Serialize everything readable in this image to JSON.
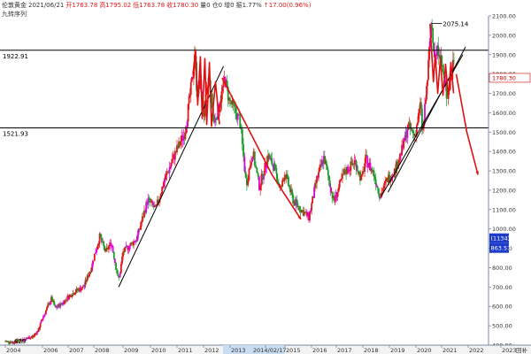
{
  "header": {
    "instrument": "伦敦黄金",
    "date": "2021/06/21",
    "open": "开1763.78",
    "high": "高1795.02",
    "low": "低1763.78",
    "close": "收1780.30",
    "volume": "量0",
    "oi": "仓0",
    "increment": "增0",
    "amplitude": "振1.77%",
    "change": "↑17.00(0.96%)"
  },
  "subtitle": "九转序列",
  "corner_label": "回补",
  "colors": {
    "up": "#e0181a",
    "down": "#1a9b2d",
    "magenta": "#e600e6",
    "red_line": "#e01010",
    "box_blue": "#1e3cc8"
  },
  "chart_data": {
    "type": "candlestick",
    "x_ticks": [
      "2004",
      "2006",
      "2007",
      "2008",
      "2009",
      "2010",
      "2011",
      "2012",
      "2013",
      "2014/02/17",
      "2015",
      "2016",
      "2017",
      "2018",
      "2019",
      "2020",
      "2021",
      "2022",
      "2023"
    ],
    "ylim": [
      400,
      2100
    ],
    "y_ticks": [
      400,
      500,
      600,
      700,
      800,
      900,
      1000,
      1100,
      1200,
      1300,
      1400,
      1500,
      1600,
      1700,
      1800,
      1900,
      2000,
      2100
    ],
    "levels": [
      1922.91,
      1521.93
    ],
    "level_labels": [
      "1922.91",
      "1521.93"
    ],
    "last_price": 1780.3,
    "last_price_label": "1780.30",
    "peak": {
      "label": "2075.14",
      "value": 2075.14,
      "date": "2020.6"
    },
    "low_label": "429",
    "cursor_value": "1000.00",
    "count_label": "(1134)",
    "low_readout": "863.57",
    "price_path": [
      [
        2004.0,
        420
      ],
      [
        2004.4,
        415
      ],
      [
        2005.0,
        430
      ],
      [
        2005.5,
        445
      ],
      [
        2005.8,
        480
      ],
      [
        2006.0,
        540
      ],
      [
        2006.35,
        640
      ],
      [
        2006.5,
        590
      ],
      [
        2006.8,
        620
      ],
      [
        2007.0,
        650
      ],
      [
        2007.3,
        680
      ],
      [
        2007.6,
        700
      ],
      [
        2007.9,
        800
      ],
      [
        2008.2,
        960
      ],
      [
        2008.4,
        880
      ],
      [
        2008.6,
        930
      ],
      [
        2008.85,
        730
      ],
      [
        2009.0,
        880
      ],
      [
        2009.5,
        950
      ],
      [
        2009.9,
        1150
      ],
      [
        2010.2,
        1100
      ],
      [
        2010.5,
        1240
      ],
      [
        2010.9,
        1380
      ],
      [
        2011.3,
        1500
      ],
      [
        2011.6,
        1800
      ],
      [
        2011.67,
        1922
      ],
      [
        2011.75,
        1700
      ],
      [
        2011.9,
        1750
      ],
      [
        2012.0,
        1580
      ],
      [
        2012.2,
        1780
      ],
      [
        2012.4,
        1550
      ],
      [
        2012.6,
        1640
      ],
      [
        2012.8,
        1780
      ],
      [
        2012.95,
        1670
      ],
      [
        2013.3,
        1560
      ],
      [
        2013.5,
        1230
      ],
      [
        2013.7,
        1400
      ],
      [
        2013.9,
        1220
      ],
      [
        2014.2,
        1380
      ],
      [
        2014.5,
        1320
      ],
      [
        2014.8,
        1200
      ],
      [
        2015.0,
        1290
      ],
      [
        2015.3,
        1150
      ],
      [
        2015.6,
        1100
      ],
      [
        2015.9,
        1060
      ],
      [
        2016.2,
        1250
      ],
      [
        2016.5,
        1370
      ],
      [
        2016.9,
        1140
      ],
      [
        2017.3,
        1290
      ],
      [
        2017.7,
        1350
      ],
      [
        2017.95,
        1250
      ],
      [
        2018.1,
        1360
      ],
      [
        2018.4,
        1290
      ],
      [
        2018.65,
        1170
      ],
      [
        2018.9,
        1250
      ],
      [
        2019.2,
        1300
      ],
      [
        2019.5,
        1420
      ],
      [
        2019.7,
        1530
      ],
      [
        2019.95,
        1480
      ],
      [
        2020.2,
        1650
      ],
      [
        2020.25,
        1470
      ],
      [
        2020.45,
        1780
      ],
      [
        2020.6,
        2075
      ],
      [
        2020.75,
        1880
      ],
      [
        2020.9,
        1940
      ],
      [
        2021.0,
        1850
      ],
      [
        2021.2,
        1680
      ],
      [
        2021.35,
        1780
      ],
      [
        2021.47,
        1900
      ],
      [
        2021.5,
        1780
      ]
    ],
    "projection": {
      "zigzag_2011": [
        [
          2011.6,
          1800
        ],
        [
          2011.7,
          1920
        ],
        [
          2011.78,
          1640
        ],
        [
          2011.88,
          1890
        ],
        [
          2011.95,
          1570
        ],
        [
          2012.05,
          1880
        ],
        [
          2012.12,
          1540
        ],
        [
          2012.22,
          1860
        ],
        [
          2012.3,
          1530
        ],
        [
          2012.45,
          1760
        ],
        [
          2012.6,
          1540
        ]
      ],
      "decline_2012": [
        [
          2012.7,
          1780
        ],
        [
          2014.4,
          1280
        ],
        [
          2015.6,
          1050
        ]
      ],
      "zigzag_2020": [
        [
          2020.55,
          2060
        ],
        [
          2020.68,
          1760
        ],
        [
          2020.75,
          1900
        ],
        [
          2020.85,
          1700
        ],
        [
          2020.95,
          1880
        ],
        [
          2021.05,
          1690
        ],
        [
          2021.15,
          1850
        ],
        [
          2021.25,
          1680
        ],
        [
          2021.35,
          1860
        ],
        [
          2021.45,
          1700
        ]
      ],
      "decline_2021": [
        [
          2021.55,
          1800
        ],
        [
          2021.95,
          1500
        ],
        [
          2022.3,
          1280
        ]
      ]
    },
    "trendlines": [
      [
        [
          2008.85,
          700
        ],
        [
          2012.75,
          1840
        ]
      ],
      [
        [
          2018.7,
          1170
        ],
        [
          2021.8,
          1900
        ]
      ],
      [
        [
          2018.95,
          1190
        ],
        [
          2021.9,
          1940
        ]
      ]
    ],
    "grid": false
  }
}
